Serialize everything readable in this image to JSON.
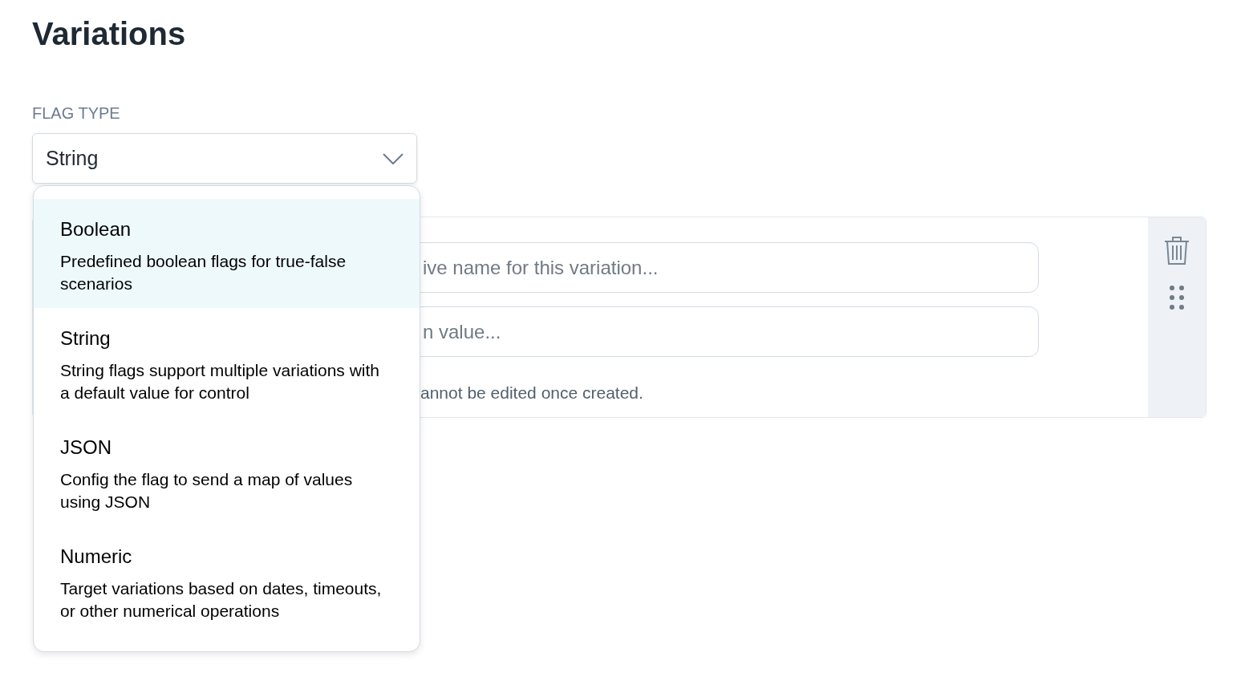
{
  "page_title": "Variations",
  "flag_type": {
    "label": "FLAG TYPE",
    "value": "String",
    "expanded": true,
    "options": [
      {
        "title": "Boolean",
        "description": "Predefined boolean flags for true-false scenarios",
        "highlighted": true
      },
      {
        "title": "String",
        "description": "String flags support multiple variations with a default value for control",
        "highlighted": false
      },
      {
        "title": "JSON",
        "description": "Config the flag to send a map of values using JSON",
        "highlighted": false
      },
      {
        "title": "Numeric",
        "description": "Target variations based on dates, timeouts, or other numerical operations",
        "highlighted": false
      }
    ]
  },
  "variation": {
    "name_placeholder": "ive name for this variation...",
    "value_placeholder": "n value...",
    "note": "annot be edited once created."
  }
}
